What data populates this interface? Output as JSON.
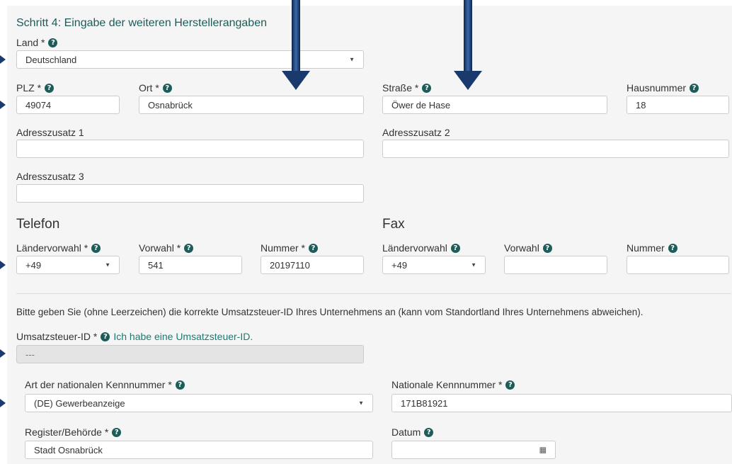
{
  "step_title": "Schritt 4: Eingabe der weiteren Herstellerangaben",
  "land": {
    "label": "Land *",
    "value": "Deutschland"
  },
  "plz": {
    "label": "PLZ *",
    "value": "49074"
  },
  "ort": {
    "label": "Ort *",
    "value": "Osnabrück"
  },
  "strasse": {
    "label": "Straße *",
    "value": "Öwer de Hase"
  },
  "hausnummer": {
    "label": "Hausnummer",
    "value": "18"
  },
  "adresszusatz1": {
    "label": "Adresszusatz 1",
    "value": ""
  },
  "adresszusatz2": {
    "label": "Adresszusatz 2",
    "value": ""
  },
  "adresszusatz3": {
    "label": "Adresszusatz 3",
    "value": ""
  },
  "telefon": {
    "heading": "Telefon",
    "laendervorwahl": {
      "label": "Ländervorwahl *",
      "value": "+49"
    },
    "vorwahl": {
      "label": "Vorwahl *",
      "value": "541"
    },
    "nummer": {
      "label": "Nummer *",
      "value": "20197110"
    }
  },
  "fax": {
    "heading": "Fax",
    "laendervorwahl": {
      "label": "Ländervorwahl",
      "value": "+49"
    },
    "vorwahl": {
      "label": "Vorwahl",
      "value": ""
    },
    "nummer": {
      "label": "Nummer",
      "value": ""
    }
  },
  "ust_hint": "Bitte geben Sie (ohne Leerzeichen) die korrekte Umsatzsteuer-ID Ihres Unternehmens an (kann vom Standortland Ihres Unternehmens abweichen).",
  "ust": {
    "label": "Umsatzsteuer-ID *",
    "link": "Ich habe eine Umsatzsteuer-ID.",
    "value": "---"
  },
  "art_kennnummer": {
    "label": "Art der nationalen Kennnummer *",
    "value": "(DE) Gewerbeanzeige"
  },
  "nationale_kennnummer": {
    "label": "Nationale Kennnummer *",
    "value": "171B81921"
  },
  "register": {
    "label": "Register/Behörde *",
    "value": "Stadt Osnabrück"
  },
  "datum": {
    "label": "Datum",
    "value": ""
  },
  "icons": {
    "help": "question-circle-icon",
    "caret": "caret-down-icon",
    "calendar": "calendar-icon"
  },
  "colors": {
    "accent": "#1c5c59",
    "arrow": "#1a3a6e",
    "panel": "#f5f5f5"
  }
}
